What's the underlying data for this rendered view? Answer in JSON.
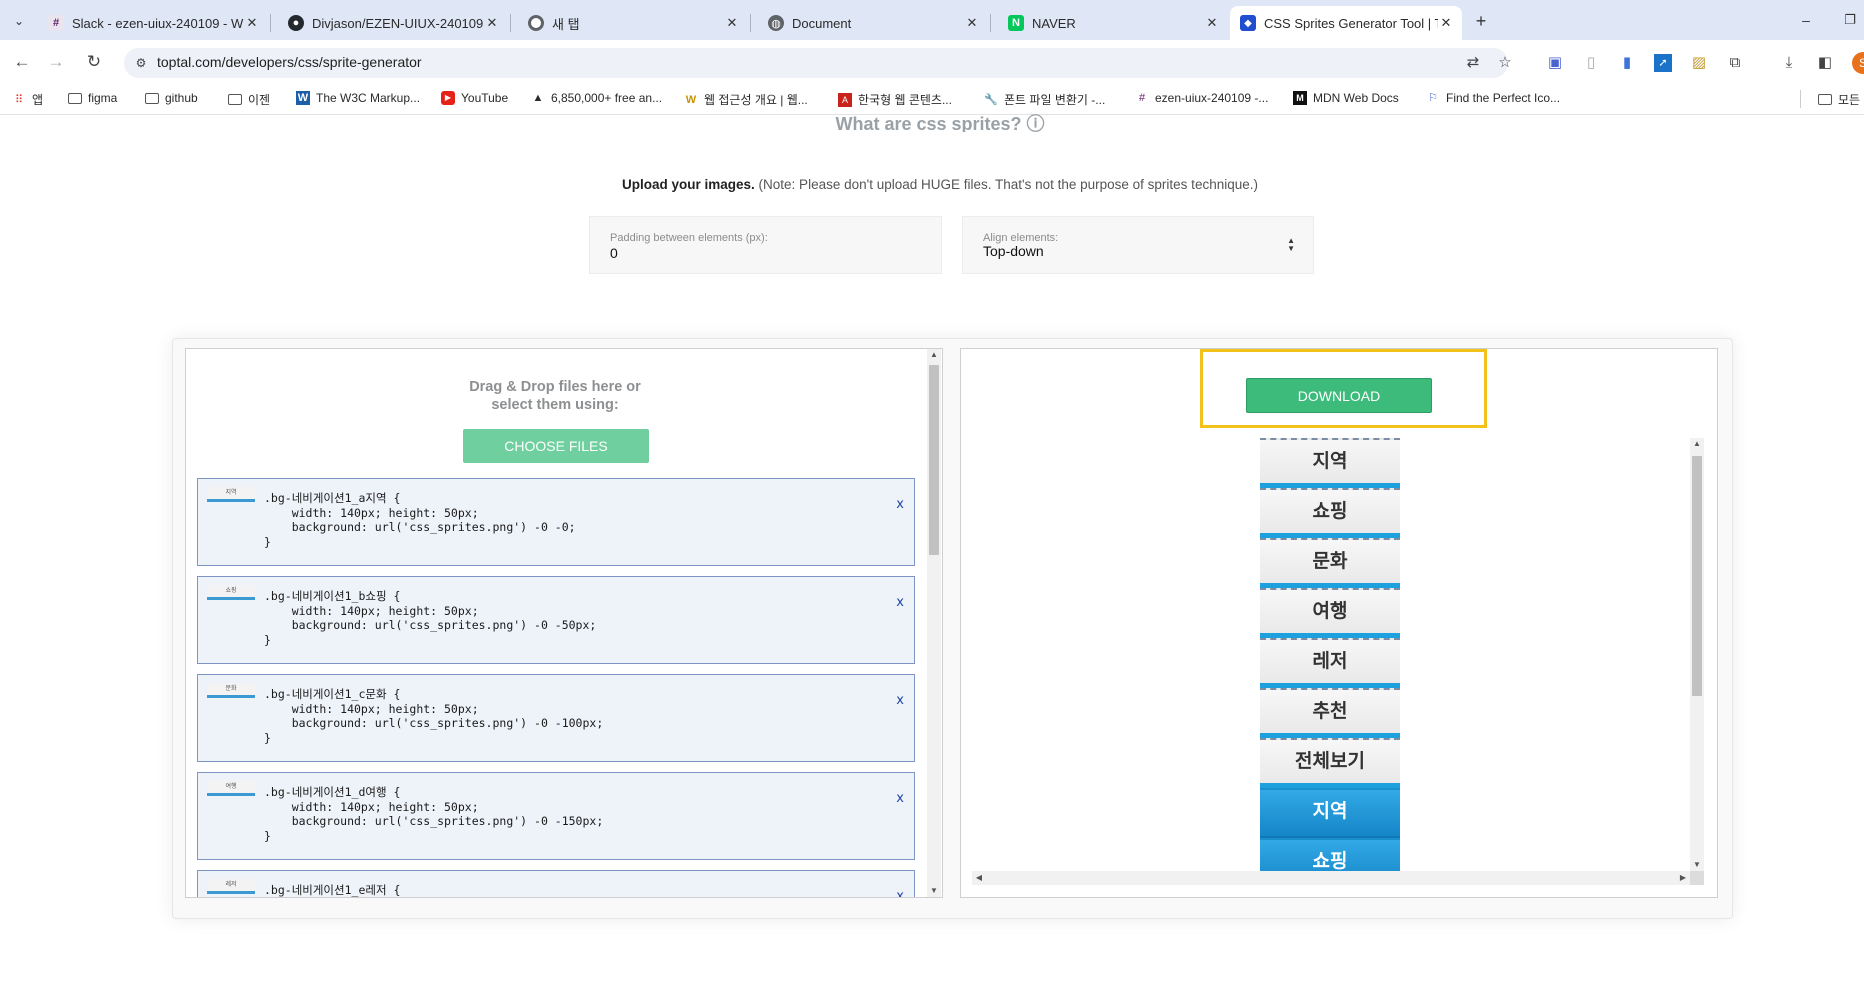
{
  "browser": {
    "tabs": [
      {
        "title": "Slack - ezen-uiux-240109 - W",
        "icon": "slack-icon",
        "color": "#611f69"
      },
      {
        "title": "Divjason/EZEN-UIUX-240109",
        "icon": "github-icon",
        "color": "#24292f"
      },
      {
        "title": "새 탭",
        "icon": "chrome-icon",
        "color": "#5f6368"
      },
      {
        "title": "Document",
        "icon": "globe-icon",
        "color": "#5f6368"
      },
      {
        "title": "NAVER",
        "icon": "naver-icon",
        "color": "#03c75a"
      },
      {
        "title": "CSS Sprites Generator Tool | To",
        "icon": "toptal-icon",
        "color": "#204ecf"
      }
    ],
    "url": "toptal.com/developers/css/sprite-generator",
    "bookmarks": [
      {
        "label": "앱",
        "icon": "apps-icon"
      },
      {
        "label": "figma",
        "icon": "folder-icon"
      },
      {
        "label": "github",
        "icon": "folder-icon"
      },
      {
        "label": "이젠",
        "icon": "folder-icon"
      },
      {
        "label": "The W3C Markup...",
        "icon": "w3c-icon"
      },
      {
        "label": "YouTube",
        "icon": "youtube-icon"
      },
      {
        "label": "6,850,000+ free an...",
        "icon": "flaticon-icon"
      },
      {
        "label": "웹 접근성 개요 | 웹...",
        "icon": "w-icon"
      },
      {
        "label": "한국형 웹 콘텐츠...",
        "icon": "pdf-icon"
      },
      {
        "label": "폰트 파일 변환기 -...",
        "icon": "wrench-icon"
      },
      {
        "label": "ezen-uiux-240109 -...",
        "icon": "slack-icon"
      },
      {
        "label": "MDN Web Docs",
        "icon": "mdn-icon"
      },
      {
        "label": "Find the Perfect Ico...",
        "icon": "flag-icon"
      },
      {
        "label": "모든",
        "icon": "folder-icon"
      }
    ],
    "profile_initial": "S"
  },
  "page": {
    "heading": "What are css sprites?",
    "upload_bold": "Upload your images.",
    "upload_note": " (Note: Please don't upload HUGE files. That's not the purpose of sprites technique.)",
    "padding_label": "Padding between elements (px):",
    "padding_value": "0",
    "align_label": "Align elements:",
    "align_value": "Top-down",
    "drag_line1": "Drag & Drop files here or",
    "drag_line2": "select them using:",
    "choose_files": "CHOOSE FILES",
    "download": "DOWNLOAD",
    "entries": [
      {
        "thumb": "지역",
        "code": ".bg-네비게이션1_a지역 {\n    width: 140px; height: 50px;\n    background: url('css_sprites.png') -0 -0;\n}"
      },
      {
        "thumb": "쇼핑",
        "code": ".bg-네비게이션1_b쇼핑 {\n    width: 140px; height: 50px;\n    background: url('css_sprites.png') -0 -50px;\n}"
      },
      {
        "thumb": "문화",
        "code": ".bg-네비게이션1_c문화 {\n    width: 140px; height: 50px;\n    background: url('css_sprites.png') -0 -100px;\n}"
      },
      {
        "thumb": "여행",
        "code": ".bg-네비게이션1_d여행 {\n    width: 140px; height: 50px;\n    background: url('css_sprites.png') -0 -150px;\n}"
      },
      {
        "thumb": "레저",
        "code": ".bg-네비게이션1_e레저 {"
      }
    ],
    "remove_label": "x",
    "sprites": [
      {
        "label": "지역",
        "active": false
      },
      {
        "label": "쇼핑",
        "active": false
      },
      {
        "label": "문화",
        "active": false
      },
      {
        "label": "여행",
        "active": false
      },
      {
        "label": "레저",
        "active": false
      },
      {
        "label": "추천",
        "active": false
      },
      {
        "label": "전체보기",
        "active": false
      },
      {
        "label": "지역",
        "active": true
      },
      {
        "label": "쇼핑",
        "active": true
      }
    ]
  }
}
